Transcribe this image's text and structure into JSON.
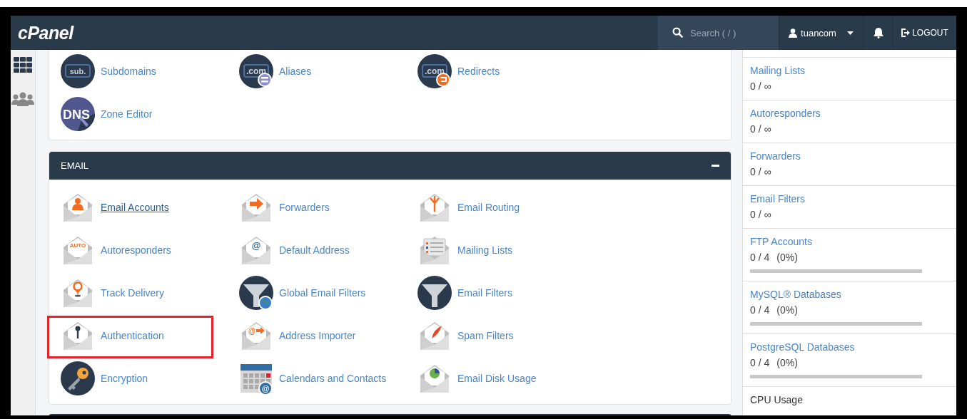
{
  "header": {
    "logo": "cPanel",
    "search": {
      "placeholder": "Search ( / )"
    },
    "user": {
      "name": "tuancom"
    },
    "logout": "LOGOUT"
  },
  "domains_card": {
    "items": [
      {
        "label": "Subdomains",
        "icon_text": "sub.",
        "hovered": false,
        "highlighted": false
      },
      {
        "label": "Aliases",
        "icon_text": ".com",
        "hovered": false,
        "highlighted": false
      },
      {
        "label": "Redirects",
        "icon_text": ".com",
        "hovered": false,
        "highlighted": false
      },
      {
        "label": "Zone Editor",
        "icon_text": "DNS",
        "hovered": false,
        "highlighted": false
      }
    ]
  },
  "email_section": {
    "title": "EMAIL",
    "expanded": true,
    "items": [
      {
        "label": "Email Accounts",
        "hovered": true,
        "highlighted": false
      },
      {
        "label": "Forwarders",
        "hovered": false,
        "highlighted": false
      },
      {
        "label": "Email Routing",
        "hovered": false,
        "highlighted": false
      },
      {
        "label": "Autoresponders",
        "icon_text": "AUTO",
        "hovered": false,
        "highlighted": false
      },
      {
        "label": "Default Address",
        "icon_text": "@",
        "hovered": false,
        "highlighted": false
      },
      {
        "label": "Mailing Lists",
        "hovered": false,
        "highlighted": false
      },
      {
        "label": "Track Delivery",
        "hovered": false,
        "highlighted": false
      },
      {
        "label": "Global Email Filters",
        "hovered": false,
        "highlighted": false
      },
      {
        "label": "Email Filters",
        "hovered": false,
        "highlighted": false
      },
      {
        "label": "Authentication",
        "hovered": false,
        "highlighted": true
      },
      {
        "label": "Address Importer",
        "icon_text": "@",
        "hovered": false,
        "highlighted": false
      },
      {
        "label": "Spam Filters",
        "hovered": false,
        "highlighted": false
      },
      {
        "label": "Encryption",
        "hovered": false,
        "highlighted": false
      },
      {
        "label": "Calendars and Contacts",
        "icon_text": "@",
        "hovered": false,
        "highlighted": false
      },
      {
        "label": "Email Disk Usage",
        "hovered": false,
        "highlighted": false
      }
    ]
  },
  "stats": [
    {
      "name": "Mailing Lists",
      "value": "0 / ∞",
      "linked": true
    },
    {
      "name": "Autoresponders",
      "value": "0 / ∞",
      "linked": true
    },
    {
      "name": "Forwarders",
      "value": "0 / ∞",
      "linked": true
    },
    {
      "name": "Email Filters",
      "value": "0 / ∞",
      "linked": true
    },
    {
      "name": "FTP Accounts",
      "value": "0 / 4",
      "percent": "(0%)",
      "linked": true,
      "level": 0
    },
    {
      "name": "MySQL® Databases",
      "value": "0 / 4",
      "percent": "(0%)",
      "linked": true,
      "level": 0
    },
    {
      "name": "PostgreSQL Databases",
      "value": "0 / 4",
      "percent": "(0%)",
      "linked": true,
      "level": 0
    },
    {
      "name": "CPU Usage",
      "linked": false
    }
  ]
}
